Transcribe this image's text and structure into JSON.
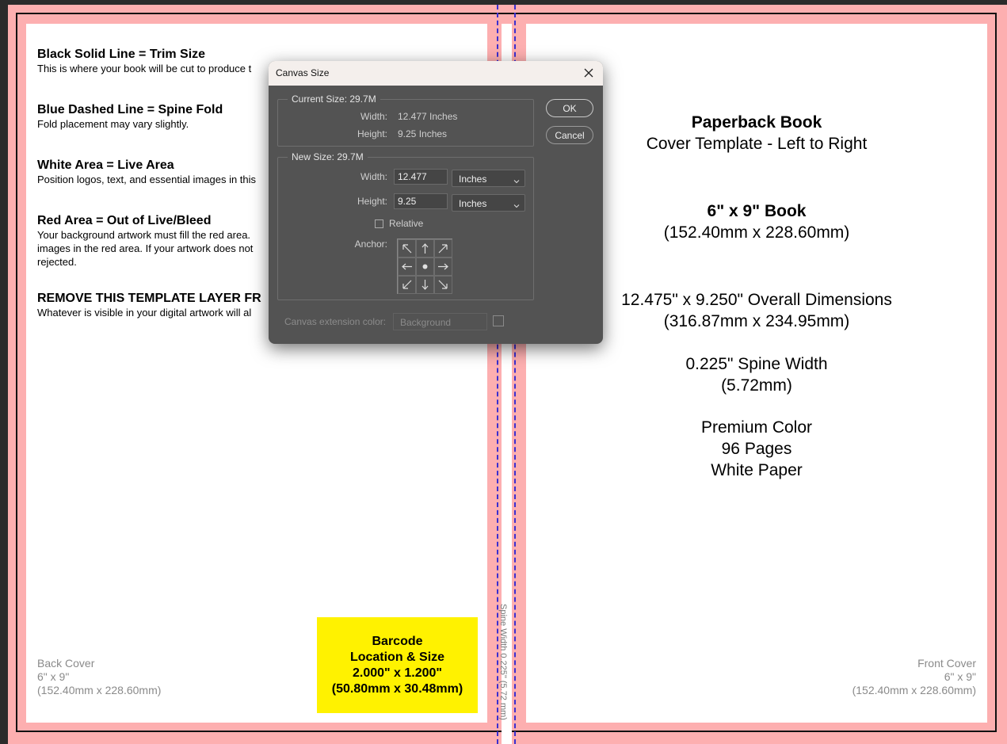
{
  "canvas": {
    "legend": [
      {
        "title": "Black Solid Line = Trim Size",
        "desc": "This is where your book will be cut to produce t"
      },
      {
        "title": "Blue Dashed Line = Spine Fold",
        "desc": "Fold placement may vary slightly."
      },
      {
        "title": "White Area = Live Area",
        "desc": "Position logos, text, and essential images in this"
      },
      {
        "title": "Red Area = Out of Live/Bleed",
        "desc": "Your background artwork must fill the red area.",
        "desc2": "images in the red area. If your artwork does not",
        "desc3": "rejected."
      },
      {
        "title": "REMOVE THIS TEMPLATE LAYER FR",
        "desc": "Whatever is visible in your digital artwork will al"
      }
    ],
    "back_cover": {
      "label": "Back Cover",
      "size": "6\" x 9\"",
      "metric": "(152.40mm x 228.60mm)"
    },
    "front_cover": {
      "label": "Front Cover",
      "size": "6\" x 9\"",
      "metric": "(152.40mm x 228.60mm)"
    },
    "barcode": {
      "line1": "Barcode",
      "line2": "Location & Size",
      "line3": "2.000\" x 1.200\"",
      "line4": "(50.80mm x 30.48mm)"
    },
    "spine_label": "Spine Width 0.225\" (5.72 mm)",
    "info": {
      "title": "Paperback Book",
      "subtitle": "Cover Template - Left to Right",
      "book_size": "6\" x 9\" Book",
      "book_metric": "(152.40mm x 228.60mm)",
      "overall": "12.475\" x 9.250\" Overall Dimensions",
      "overall_metric": "(316.87mm x 234.95mm)",
      "spine": "0.225\" Spine Width",
      "spine_metric": "(5.72mm)",
      "color": "Premium Color",
      "pages": "96 Pages",
      "paper": "White Paper"
    },
    "colors": {
      "bleed": "#fdafb0",
      "spine_fold": "#3b2fd0",
      "barcode": "#fff200"
    }
  },
  "dialog": {
    "title": "Canvas Size",
    "current": {
      "legend": "Current Size: 29.7M",
      "width_label": "Width:",
      "width_value": "12.477 Inches",
      "height_label": "Height:",
      "height_value": "9.25 Inches"
    },
    "new": {
      "legend": "New Size: 29.7M",
      "width_label": "Width:",
      "width_value": "12.477",
      "width_unit": "Inches",
      "height_label": "Height:",
      "height_value": "9.25",
      "height_unit": "Inches",
      "relative_label": "Relative",
      "anchor_label": "Anchor:"
    },
    "ok_label": "OK",
    "cancel_label": "Cancel",
    "extension_label": "Canvas extension color:",
    "extension_value": "Background"
  }
}
